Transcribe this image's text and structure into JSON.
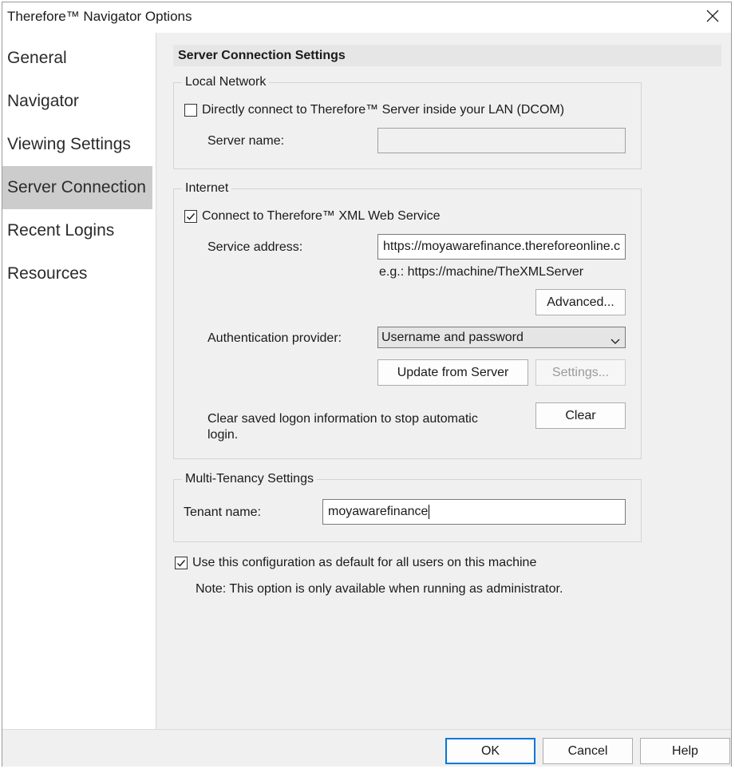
{
  "window": {
    "title": "Therefore™ Navigator Options"
  },
  "sidebar": {
    "items": [
      {
        "label": "General"
      },
      {
        "label": "Navigator"
      },
      {
        "label": "Viewing Settings"
      },
      {
        "label": "Server Connection",
        "selected": true
      },
      {
        "label": "Recent Logins"
      },
      {
        "label": "Resources"
      }
    ]
  },
  "main": {
    "heading": "Server Connection Settings",
    "local_network": {
      "legend": "Local Network",
      "dcom_checkbox_label": "Directly connect to Therefore™ Server inside your LAN (DCOM)",
      "dcom_checked": false,
      "server_name_label": "Server name:",
      "server_name_value": ""
    },
    "internet": {
      "legend": "Internet",
      "xml_checkbox_label": "Connect to Therefore™ XML Web Service",
      "xml_checked": true,
      "service_address_label": "Service address:",
      "service_address_value": "https://moyawarefinance.thereforeonline.c",
      "example_text": "e.g.: https://machine/TheXMLServer",
      "advanced_button": "Advanced...",
      "auth_provider_label": "Authentication provider:",
      "auth_provider_value": "Username and password",
      "update_button": "Update from Server",
      "settings_button": "Settings...",
      "clear_text": "Clear saved logon information to stop automatic login.",
      "clear_button": "Clear"
    },
    "multi_tenancy": {
      "legend": "Multi-Tenancy Settings",
      "tenant_label": "Tenant name:",
      "tenant_value": "moyawarefinance"
    },
    "default_config": {
      "checkbox_label": "Use this configuration as default for all users on this machine",
      "checked": true,
      "note": "Note: This option is only available when running as administrator."
    }
  },
  "footer": {
    "ok": "OK",
    "cancel": "Cancel",
    "help": "Help"
  },
  "colors": {
    "selected_nav_bg": "#cccccc",
    "default_button_border": "#0078d7"
  }
}
